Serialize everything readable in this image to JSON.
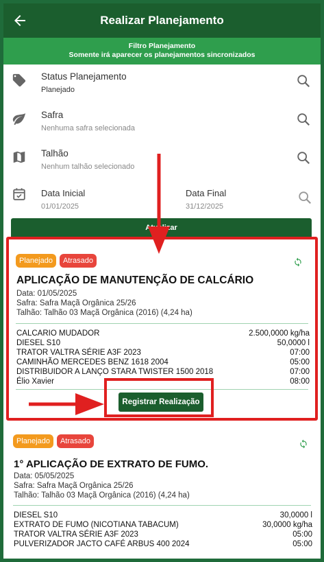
{
  "appbar": {
    "title": "Realizar Planejamento",
    "back_icon": "arrow-left-icon"
  },
  "filter_banner": {
    "line1": "Filtro Planejamento",
    "line2": "Somente irá aparecer os planejamentos sincronizados"
  },
  "filters": {
    "status": {
      "label": "Status Planejamento",
      "value": "Planejado",
      "icon": "tag-icon"
    },
    "safra": {
      "label": "Safra",
      "value": "Nenhuma safra selecionada",
      "icon": "leaf-icon"
    },
    "talhao": {
      "label": "Talhão",
      "value": "Nenhum talhão selecionado",
      "icon": "map-icon"
    },
    "data_inicial": {
      "label": "Data Inicial",
      "value": "01/01/2025",
      "icon": "calendar-icon"
    },
    "data_final": {
      "label": "Data Final",
      "value": "31/12/2025"
    }
  },
  "update_button": "Atualizar",
  "cards": [
    {
      "badge1": "Planejado",
      "badge2": "Atrasado",
      "title": "APLICAÇÃO DE MANUTENÇÃO DE CALCÁRIO",
      "data": "Data: 01/05/2025",
      "safra": "Safra: Safra Maçã Orgânica 25/26",
      "talhao": "Talhão: Talhão 03 Maçã Orgânica (2016) (4,24 ha)",
      "items": [
        {
          "name": "CALCARIO MUDADOR",
          "value": "2.500,0000 kg/ha"
        },
        {
          "name": "DIESEL S10",
          "value": "50,0000 l"
        },
        {
          "name": "TRATOR VALTRA SÉRIE A3F 2023",
          "value": "07:00"
        },
        {
          "name": "CAMINHÃO MERCEDES BENZ 1618 2004",
          "value": "05:00"
        },
        {
          "name": "DISTRIBUIDOR A LANÇO STARA TWISTER 1500 2018",
          "value": "07:00"
        },
        {
          "name": "Élio Xavier",
          "value": "08:00"
        }
      ],
      "register_button": "Registrar Realização"
    },
    {
      "badge1": "Planejado",
      "badge2": "Atrasado",
      "title": "1° APLICAÇÃO DE EXTRATO DE FUMO.",
      "data": "Data: 05/05/2025",
      "safra": "Safra: Safra Maçã Orgânica 25/26",
      "talhao": "Talhão: Talhão 03 Maçã Orgânica (2016) (4,24 ha)",
      "items": [
        {
          "name": "DIESEL S10",
          "value": "30,0000 l"
        },
        {
          "name": "EXTRATO DE FUMO (NICOTIANA TABACUM)",
          "value": "30,0000 kg/ha"
        },
        {
          "name": "TRATOR VALTRA SÉRIE A3F 2023",
          "value": "05:00"
        },
        {
          "name": "PULVERIZADOR JACTO CAFÉ ARBUS 400 2024",
          "value": "05:00"
        }
      ]
    }
  ],
  "colors": {
    "primary": "#1b5e2e",
    "banner": "#2f9e4d",
    "badge_planejado": "#f39a1e",
    "badge_atrasado": "#e8453c",
    "highlight": "#e02020"
  }
}
